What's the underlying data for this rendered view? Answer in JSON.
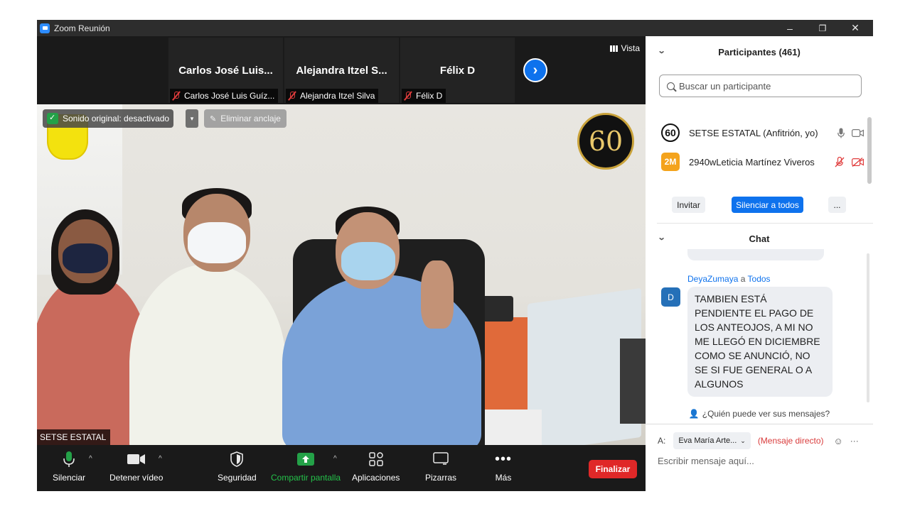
{
  "window": {
    "title": "Zoom Reunión",
    "minimize": "–",
    "restore": "❐",
    "close": "✕"
  },
  "strip": {
    "thumbs": [
      {
        "name": "Carlos José Luis...",
        "label": "Carlos José Luis Guíz..."
      },
      {
        "name": "Alejandra Itzel S...",
        "label": "Alejandra Itzel Silva"
      },
      {
        "name": "Félix D",
        "label": "Félix D"
      }
    ],
    "next": "›",
    "view_label": "Vista"
  },
  "video": {
    "sound_label": "Sonido original: desactivado",
    "caret": "▾",
    "unpin_label": "Eliminar anclaje",
    "logo_number": "60",
    "speaker_name": "SETSE ESTATAL"
  },
  "toolbar": {
    "mute": "Silenciar",
    "stop_video": "Detener vídeo",
    "security": "Seguridad",
    "share": "Compartir pantalla",
    "apps": "Aplicaciones",
    "whiteboards": "Pizarras",
    "more": "Más",
    "end": "Finalizar",
    "caret": "^"
  },
  "participants": {
    "title": "Participantes (461)",
    "search_placeholder": "Buscar un participante",
    "list": [
      {
        "avatar": "60",
        "name": "SETSE ESTATAL (Anfitrión, yo)"
      },
      {
        "avatar": "2M",
        "name": "2940wLeticia Martínez Viveros"
      }
    ],
    "invite": "Invitar",
    "mute_all": "Silenciar a todos",
    "more": "..."
  },
  "chat": {
    "title": "Chat",
    "sender": "DeyaZumaya",
    "to_word": "a",
    "recipient": "Todos",
    "avatar": "D",
    "message": "TAMBIEN ESTÁ PENDIENTE EL PAGO DE LOS ANTEOJOS, A MI NO ME LLEGÓ EN DICIEMBRE COMO SE ANUNCIÓ, NO SE SI FUE GENERAL O A ALGUNOS",
    "who_sees": "¿Quién puede ver sus mensajes?",
    "to_label": "A:",
    "to_value": "Eva María Arte...",
    "direct_label": "(Mensaje directo)",
    "compose_placeholder": "Escribir mensaje aquí..."
  },
  "colors": {
    "accent": "#0e72ed",
    "end": "#e02828",
    "share": "#24a148",
    "muted": "#e03c3c"
  }
}
